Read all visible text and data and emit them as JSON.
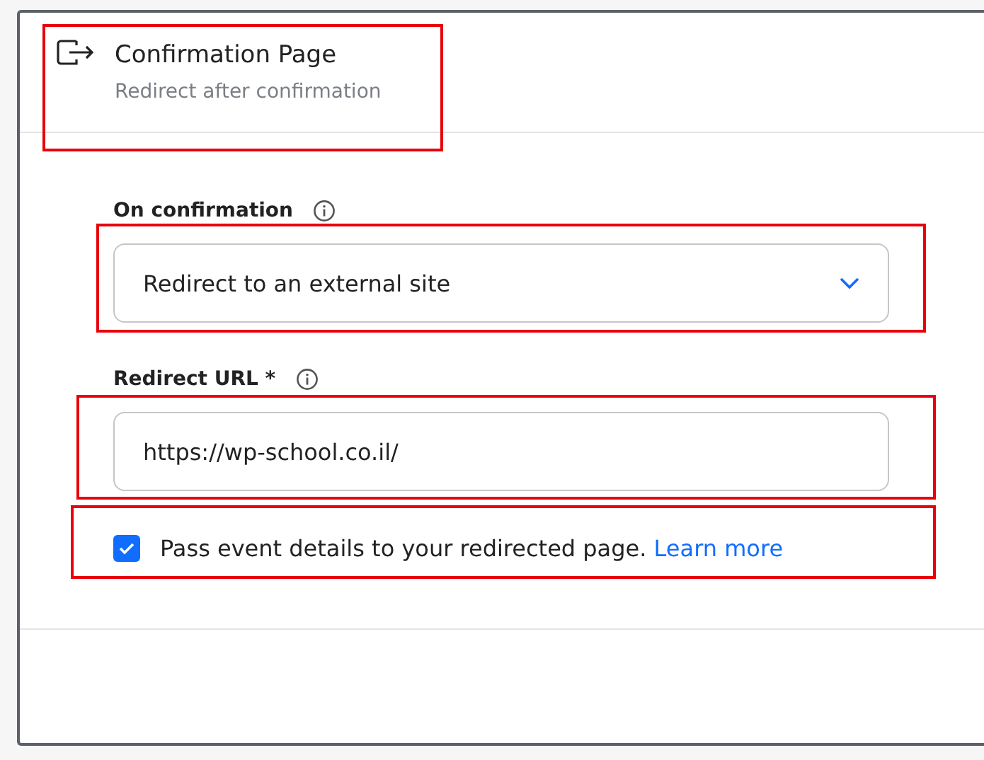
{
  "header": {
    "title": "Confirmation Page",
    "subtitle": "Redirect after confirmation",
    "highlighted": true
  },
  "on_confirmation": {
    "label": "On confirmation",
    "value": "Redirect to an external site",
    "highlighted": true
  },
  "redirect_url": {
    "label": "Redirect URL *",
    "value": "https://wp-school.co.il/",
    "highlighted": true
  },
  "pass_event_details": {
    "label": "Pass event details to your redirected page.",
    "link": "Learn more",
    "checked": true,
    "highlighted": true
  }
}
